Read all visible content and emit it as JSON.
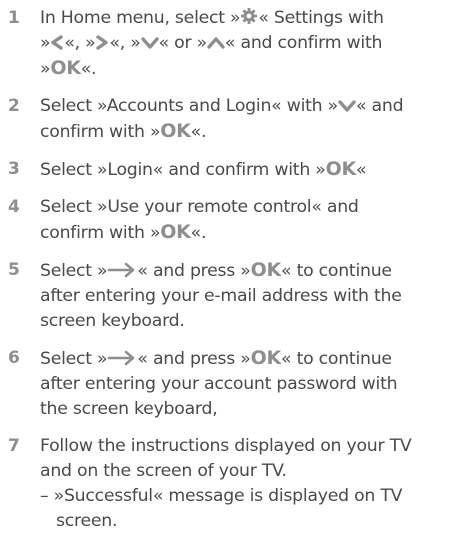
{
  "colors": {
    "text": "#4a4a4a",
    "number": "#8e8e8e"
  },
  "icons": {
    "gear": "gear-icon",
    "left": "left-chevron-icon",
    "right": "right-chevron-icon",
    "down": "down-chevron-icon",
    "up": "up-chevron-icon",
    "arrow": "right-arrow-icon"
  },
  "ok": "OK",
  "steps": [
    {
      "number": "1",
      "t1": "In Home menu, select »",
      "t2": "« Settings with",
      "t3": "»",
      "t4": "«, »",
      "t5": "«, »",
      "t6": "« or »",
      "t7": "« and confirm with",
      "t8": "»",
      "t9": "«."
    },
    {
      "number": "2",
      "t1": "Select »Accounts and Login« with »",
      "t2": "« and",
      "t3": "confirm with »",
      "t4": "«."
    },
    {
      "number": "3",
      "t1": "Select »Login« and confirm with »",
      "t2": "«"
    },
    {
      "number": "4",
      "t1": "Select »Use your remote control« and",
      "t2": "confirm with »",
      "t3": "«."
    },
    {
      "number": "5",
      "t1": "Select »",
      "t2": "« and press »",
      "t3": "« to continue",
      "t4": "after entering your e-mail address with the",
      "t5": "screen keyboard."
    },
    {
      "number": "6",
      "t1": "Select »",
      "t2": "« and press »",
      "t3": "« to continue",
      "t4": "after entering your account password with",
      "t5": "the screen keyboard,"
    },
    {
      "number": "7",
      "t1": "Follow the instructions displayed on your TV",
      "t2": "and on the screen of your TV.",
      "t3": "– »Successful« message is displayed on TV",
      "t4": "screen."
    }
  ]
}
